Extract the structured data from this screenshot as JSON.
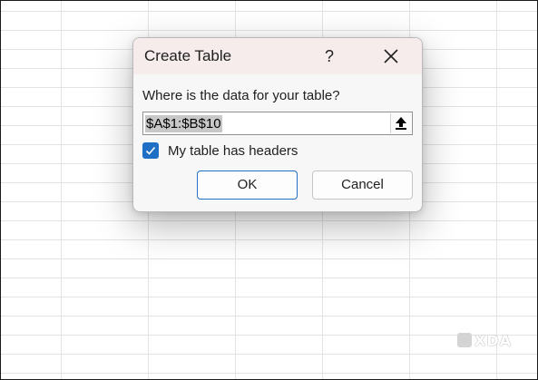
{
  "dialog": {
    "title": "Create Table",
    "help_label": "?",
    "close_icon": "close-icon",
    "prompt": "Where is the data for your table?",
    "range_value": "$A$1:$B$10",
    "collapse_icon": "upload-arrow-icon",
    "headers_checkbox": {
      "label": "My table has headers",
      "checked": true,
      "color": "#1f6fc5"
    },
    "ok_label": "OK",
    "cancel_label": "Cancel"
  },
  "watermark": {
    "text": "XDA"
  }
}
